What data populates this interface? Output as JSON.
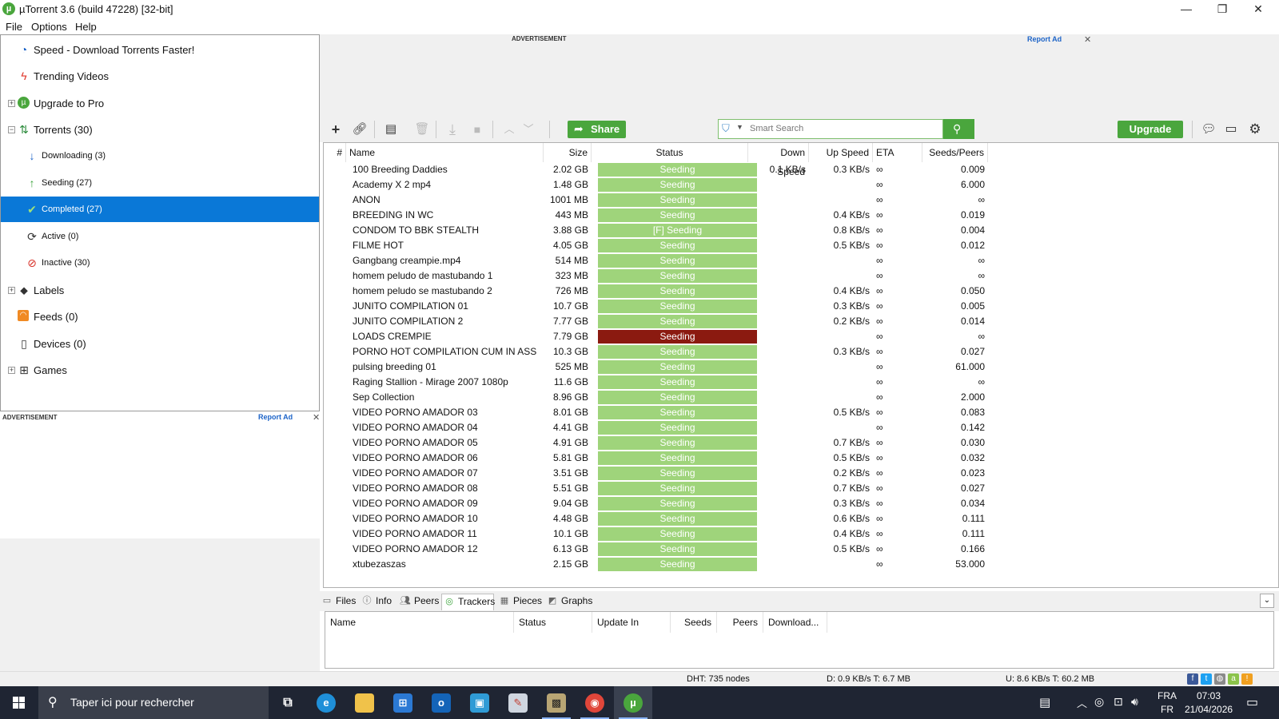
{
  "window": {
    "title": "µTorrent 3.6  (build 47228) [32-bit]",
    "logo_glyph": "µ",
    "minimize_glyph": "—",
    "restore_glyph": "❐",
    "close_glyph": "✕"
  },
  "menu": {
    "file": "File",
    "options": "Options",
    "help": "Help"
  },
  "sidebar": {
    "speed": "Speed - Download Torrents Faster!",
    "trending": "Trending Videos",
    "upgrade": "Upgrade to Pro",
    "torrents": "Torrents (30)",
    "downloading": "Downloading (3)",
    "seeding": "Seeding (27)",
    "completed": "Completed (27)",
    "active": "Active (0)",
    "inactive": "Inactive (30)",
    "labels": "Labels",
    "feeds": "Feeds (0)",
    "devices": "Devices (0)",
    "games": "Games",
    "expand_plus": "+",
    "expand_minus": "−"
  },
  "ads": {
    "label": "ADVERTISEMENT",
    "report": "Report Ad",
    "close": "✕"
  },
  "toolbar": {
    "share_label": "Share",
    "search_placeholder": "Smart Search",
    "upgrade_label": "Upgrade"
  },
  "columns": {
    "num": "#",
    "name": "Name",
    "size": "Size",
    "status": "Status",
    "down_speed": "Down Speed",
    "up_speed": "Up Speed",
    "eta": "ETA",
    "seeds_peers": "Seeds/Peers"
  },
  "torrents": [
    {
      "name": "100 Breeding Daddies",
      "size": "2.02 GB",
      "status": "Seeding",
      "down": "0.1 KB/s",
      "up": "0.3 KB/s",
      "eta": "∞",
      "ratio": "0.009",
      "alert": false
    },
    {
      "name": "Academy X 2 mp4",
      "size": "1.48 GB",
      "status": "Seeding",
      "down": "",
      "up": "",
      "eta": "∞",
      "ratio": "6.000",
      "alert": false
    },
    {
      "name": "ANON",
      "size": "1001 MB",
      "status": "Seeding",
      "down": "",
      "up": "",
      "eta": "∞",
      "ratio": "∞",
      "alert": false
    },
    {
      "name": "BREEDING IN WC",
      "size": "443 MB",
      "status": "Seeding",
      "down": "",
      "up": "0.4 KB/s",
      "eta": "∞",
      "ratio": "0.019",
      "alert": false
    },
    {
      "name": "CONDOM TO BBK STEALTH",
      "size": "3.88 GB",
      "status": "[F] Seeding",
      "down": "",
      "up": "0.8 KB/s",
      "eta": "∞",
      "ratio": "0.004",
      "alert": false
    },
    {
      "name": "FILME HOT",
      "size": "4.05 GB",
      "status": "Seeding",
      "down": "",
      "up": "0.5 KB/s",
      "eta": "∞",
      "ratio": "0.012",
      "alert": false
    },
    {
      "name": "Gangbang creampie.mp4",
      "size": "514 MB",
      "status": "Seeding",
      "down": "",
      "up": "",
      "eta": "∞",
      "ratio": "∞",
      "alert": false
    },
    {
      "name": "homem peludo de mastubando 1",
      "size": "323 MB",
      "status": "Seeding",
      "down": "",
      "up": "",
      "eta": "∞",
      "ratio": "∞",
      "alert": false
    },
    {
      "name": "homem peludo se mastubando 2",
      "size": "726 MB",
      "status": "Seeding",
      "down": "",
      "up": "0.4 KB/s",
      "eta": "∞",
      "ratio": "0.050",
      "alert": false
    },
    {
      "name": "JUNITO COMPILATION 01",
      "size": "10.7 GB",
      "status": "Seeding",
      "down": "",
      "up": "0.3 KB/s",
      "eta": "∞",
      "ratio": "0.005",
      "alert": false
    },
    {
      "name": "JUNITO COMPILATION 2",
      "size": "7.77 GB",
      "status": "Seeding",
      "down": "",
      "up": "0.2 KB/s",
      "eta": "∞",
      "ratio": "0.014",
      "alert": false
    },
    {
      "name": "LOADS CREMPIE",
      "size": "7.79 GB",
      "status": "Seeding",
      "down": "",
      "up": "",
      "eta": "∞",
      "ratio": "∞",
      "alert": true
    },
    {
      "name": "PORNO HOT COMPILATION CUM IN ASS",
      "size": "10.3 GB",
      "status": "Seeding",
      "down": "",
      "up": "0.3 KB/s",
      "eta": "∞",
      "ratio": "0.027",
      "alert": false
    },
    {
      "name": "pulsing breeding 01",
      "size": "525 MB",
      "status": "Seeding",
      "down": "",
      "up": "",
      "eta": "∞",
      "ratio": "61.000",
      "alert": false
    },
    {
      "name": "Raging Stallion - Mirage 2007 1080p",
      "size": "11.6 GB",
      "status": "Seeding",
      "down": "",
      "up": "",
      "eta": "∞",
      "ratio": "∞",
      "alert": false
    },
    {
      "name": "Sep Collection",
      "size": "8.96 GB",
      "status": "Seeding",
      "down": "",
      "up": "",
      "eta": "∞",
      "ratio": "2.000",
      "alert": false
    },
    {
      "name": "VIDEO PORNO AMADOR 03",
      "size": "8.01 GB",
      "status": "Seeding",
      "down": "",
      "up": "0.5 KB/s",
      "eta": "∞",
      "ratio": "0.083",
      "alert": false
    },
    {
      "name": "VIDEO PORNO AMADOR 04",
      "size": "4.41 GB",
      "status": "Seeding",
      "down": "",
      "up": "",
      "eta": "∞",
      "ratio": "0.142",
      "alert": false
    },
    {
      "name": "VIDEO PORNO AMADOR 05",
      "size": "4.91 GB",
      "status": "Seeding",
      "down": "",
      "up": "0.7 KB/s",
      "eta": "∞",
      "ratio": "0.030",
      "alert": false
    },
    {
      "name": "VIDEO PORNO AMADOR 06",
      "size": "5.81 GB",
      "status": "Seeding",
      "down": "",
      "up": "0.5 KB/s",
      "eta": "∞",
      "ratio": "0.032",
      "alert": false
    },
    {
      "name": "VIDEO PORNO AMADOR 07",
      "size": "3.51 GB",
      "status": "Seeding",
      "down": "",
      "up": "0.2 KB/s",
      "eta": "∞",
      "ratio": "0.023",
      "alert": false
    },
    {
      "name": "VIDEO PORNO AMADOR 08",
      "size": "5.51 GB",
      "status": "Seeding",
      "down": "",
      "up": "0.7 KB/s",
      "eta": "∞",
      "ratio": "0.027",
      "alert": false
    },
    {
      "name": "VIDEO PORNO AMADOR 09",
      "size": "9.04 GB",
      "status": "Seeding",
      "down": "",
      "up": "0.3 KB/s",
      "eta": "∞",
      "ratio": "0.034",
      "alert": false
    },
    {
      "name": "VIDEO PORNO AMADOR 10",
      "size": "4.48 GB",
      "status": "Seeding",
      "down": "",
      "up": "0.6 KB/s",
      "eta": "∞",
      "ratio": "0.111",
      "alert": false
    },
    {
      "name": "VIDEO PORNO AMADOR 11",
      "size": "10.1 GB",
      "status": "Seeding",
      "down": "",
      "up": "0.4 KB/s",
      "eta": "∞",
      "ratio": "0.111",
      "alert": false
    },
    {
      "name": "VIDEO PORNO AMADOR 12",
      "size": "6.13 GB",
      "status": "Seeding",
      "down": "",
      "up": "0.5 KB/s",
      "eta": "∞",
      "ratio": "0.166",
      "alert": false
    },
    {
      "name": "xtubezaszas",
      "size": "2.15 GB",
      "status": "Seeding",
      "down": "",
      "up": "",
      "eta": "∞",
      "ratio": "53.000",
      "alert": false
    }
  ],
  "tabs": {
    "files": "Files",
    "info": "Info",
    "peers": "Peers",
    "trackers": "Trackers",
    "pieces": "Pieces",
    "graphs": "Graphs"
  },
  "tracker_columns": {
    "name": "Name",
    "status": "Status",
    "update_in": "Update In",
    "seeds": "Seeds",
    "peers": "Peers",
    "download": "Download..."
  },
  "statusbar": {
    "dht": "DHT: 735 nodes",
    "download": "D: 0.9 KB/s T: 6.7 MB",
    "upload": "U: 8.6 KB/s T: 60.2 MB",
    "facebook_glyph": "f",
    "twitter_glyph": "t",
    "web_glyph": "◍",
    "android_glyph": "a",
    "warning_glyph": "!"
  },
  "taskbar": {
    "search_placeholder": "Taper ici pour rechercher",
    "lang_line1": "FRA",
    "lang_line2": "FR",
    "time": "07:03",
    "date": "21/04/2026",
    "colors": {
      "edge": "#1f8fd8",
      "explorer": "#f0c24a",
      "store": "#2b79d4",
      "outlook": "#1464b8",
      "remote": "#2f9bd6",
      "notes": "#cfd6e0",
      "media": "#b8a574",
      "chrome": "#e0463a",
      "utorrent": "#4aa63d"
    }
  },
  "colors": {
    "accent_green": "#4aa63d",
    "seeding_green": "#9fd47b",
    "alert_red": "#8b1a10",
    "selected_blue": "#0a78d7"
  }
}
